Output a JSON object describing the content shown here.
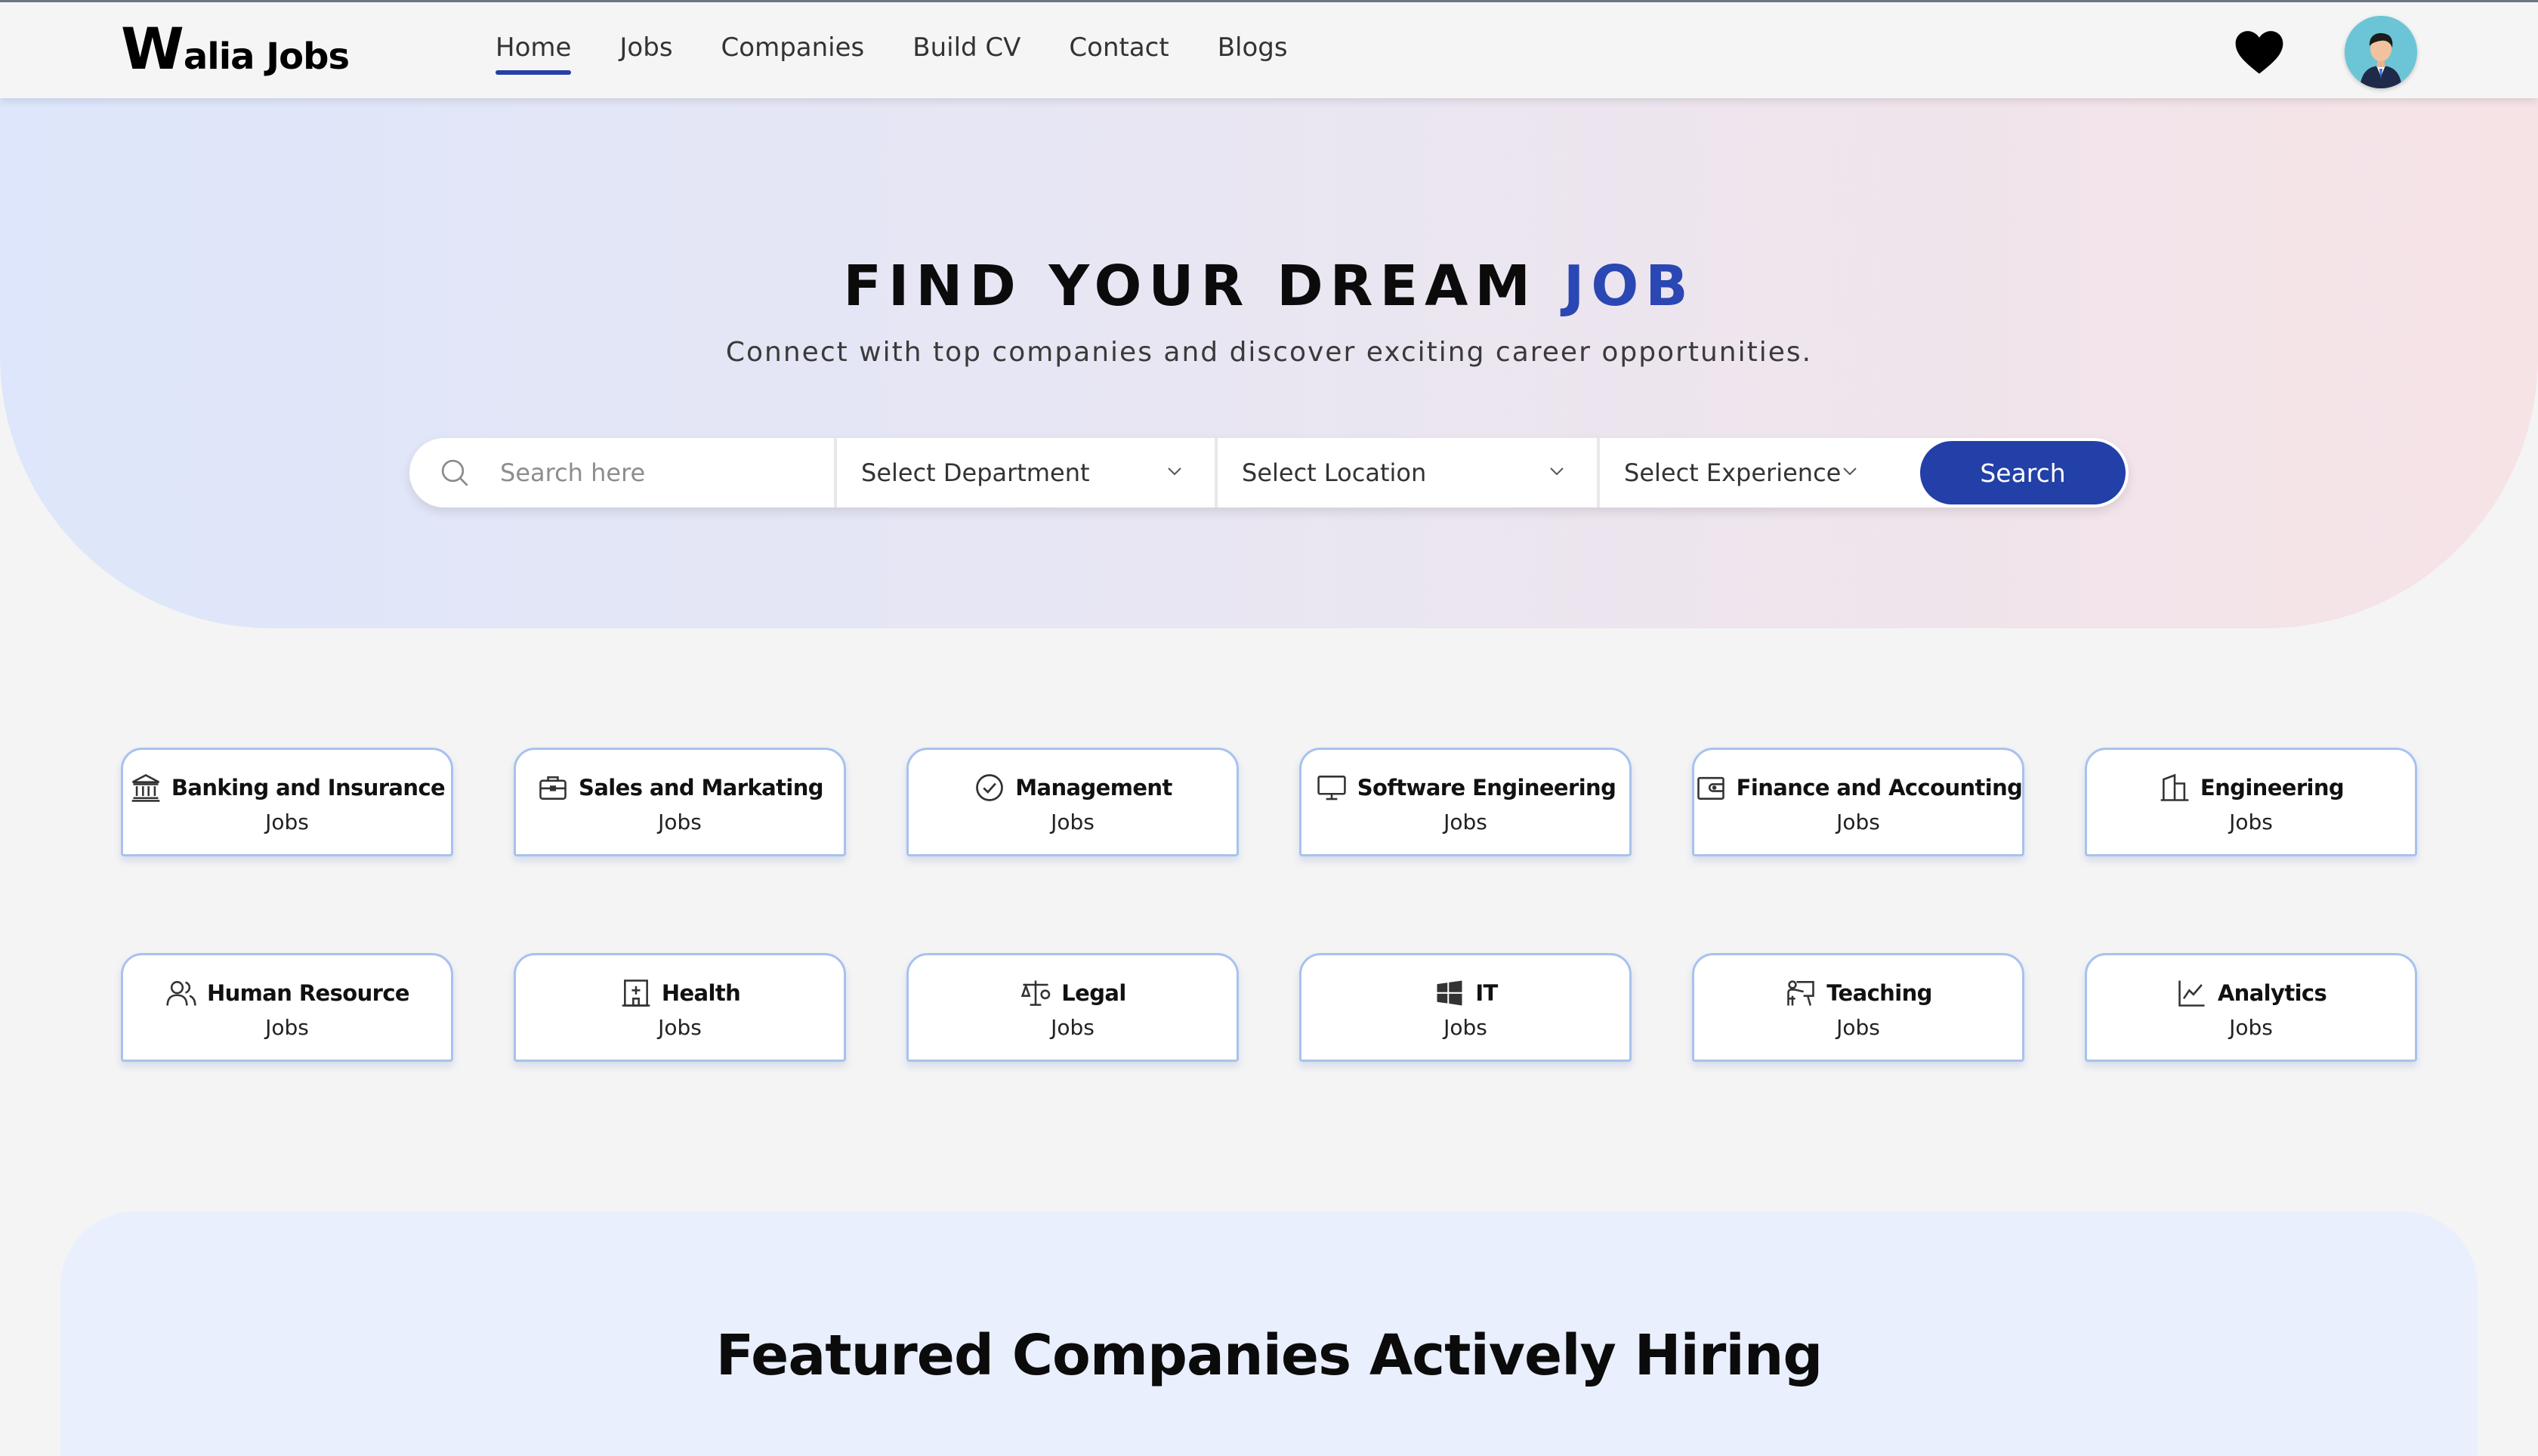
{
  "brand": {
    "logo_w": "W",
    "logo_rest": "alia Jobs"
  },
  "nav": {
    "items": [
      "Home",
      "Jobs",
      "Companies",
      "Build CV",
      "Contact",
      "Blogs"
    ],
    "active": "Home"
  },
  "header_icons": {
    "favorites": "heart-icon",
    "avatar": "user-avatar"
  },
  "hero": {
    "title_main": "FIND YOUR DREAM ",
    "title_accent": "JOB",
    "subtitle": "Connect with top companies and discover exciting career opportunities."
  },
  "search": {
    "placeholder": "Search here",
    "department": "Select Department",
    "location": "Select Location",
    "experience": "Select Experience",
    "button": "Search"
  },
  "categories": [
    {
      "name": "Banking and Insurance",
      "sub": "Jobs",
      "icon": "bank-icon"
    },
    {
      "name": "Sales and Markating",
      "sub": "Jobs",
      "icon": "briefcase-icon"
    },
    {
      "name": "Management",
      "sub": "Jobs",
      "icon": "check-circle-icon"
    },
    {
      "name": "Software Engineering",
      "sub": "Jobs",
      "icon": "monitor-icon"
    },
    {
      "name": "Finance and Accounting",
      "sub": "Jobs",
      "icon": "wallet-icon"
    },
    {
      "name": "Engineering",
      "sub": "Jobs",
      "icon": "building-icon"
    },
    {
      "name": "Human Resource",
      "sub": "Jobs",
      "icon": "people-icon"
    },
    {
      "name": "Health",
      "sub": "Jobs",
      "icon": "hospital-icon"
    },
    {
      "name": "Legal",
      "sub": "Jobs",
      "icon": "scales-icon"
    },
    {
      "name": "IT",
      "sub": "Jobs",
      "icon": "windows-icon"
    },
    {
      "name": "Teaching",
      "sub": "Jobs",
      "icon": "teacher-icon"
    },
    {
      "name": "Analytics",
      "sub": "Jobs",
      "icon": "line-chart-icon"
    }
  ],
  "featured": {
    "title": "Featured Companies Actively Hiring"
  },
  "colors": {
    "accent": "#2340a8",
    "card_border": "#a8c2ee",
    "hero_left": "#dde6fb",
    "hero_right": "#f6e3e6",
    "featured_bg": "#e9effd"
  }
}
